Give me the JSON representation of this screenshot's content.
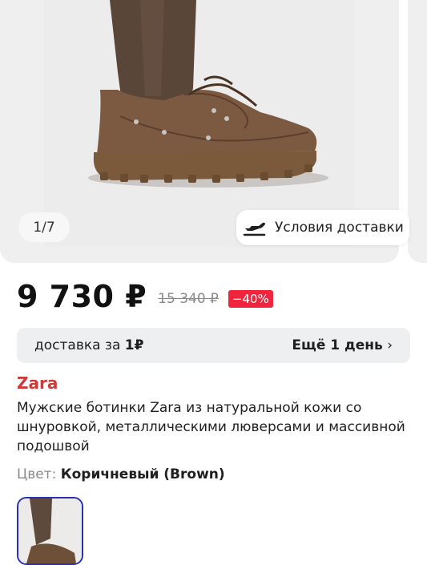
{
  "gallery": {
    "counter": "1/7",
    "delivery_chip_label": "Условия доставки",
    "delivery_chip_icon": "airplane-departure-icon"
  },
  "price": {
    "current": "9 730 ₽",
    "old": "15 340 ₽",
    "discount": "−40%"
  },
  "delivery": {
    "prefix": "доставка за ",
    "price": "1₽",
    "more": "Ещё 1 день",
    "chevron": "›"
  },
  "product": {
    "brand": "Zara",
    "title": "Мужские ботинки Zara из натуральной кожи со шнуровкой, металлическими люверсами и массивной подошвой",
    "color_label": "Цвет: ",
    "color_value": "Коричневый (Brown)"
  },
  "colors": {
    "brand_red": "#d23838",
    "discount_red": "#f0243c",
    "swatch_border": "#2a2fb5"
  }
}
